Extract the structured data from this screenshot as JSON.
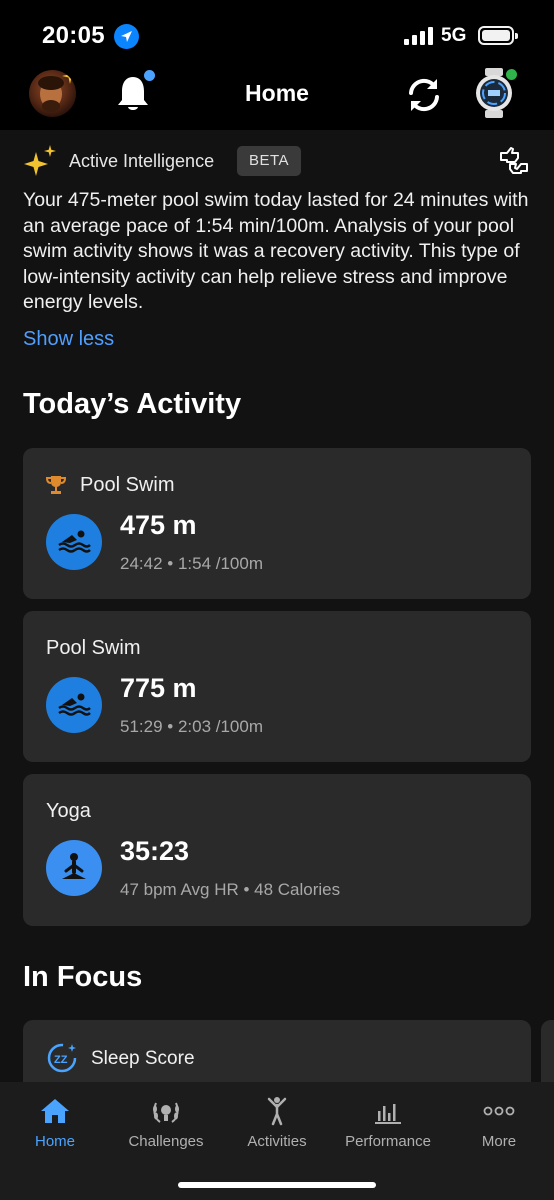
{
  "status_bar": {
    "time": "20:05",
    "network": "5G"
  },
  "header": {
    "title": "Home"
  },
  "insight": {
    "label": "Active Intelligence",
    "badge": "BETA",
    "text": "Your 475-meter pool swim today lasted for 24 minutes with an average pace of 1:54 min/100m. Analysis of your pool swim activity shows it was a recovery activity. This type of low-intensity activity can help relieve stress and improve energy levels.",
    "show_less": "Show less"
  },
  "today": {
    "title": "Today’s Activity",
    "activities": [
      {
        "name": "Pool Swim",
        "metric": "475 m",
        "detail": "24:42 • 1:54 /100m",
        "icon": "swim-icon",
        "badge_icon": "trophy-icon"
      },
      {
        "name": "Pool Swim",
        "metric": "775 m",
        "detail": "51:29 • 2:03 /100m",
        "icon": "swim-icon"
      },
      {
        "name": "Yoga",
        "metric": "35:23",
        "detail": "47 bpm Avg HR • 48 Calories",
        "icon": "yoga-icon"
      }
    ]
  },
  "in_focus": {
    "title": "In Focus",
    "cards": [
      {
        "label": "Sleep Score",
        "icon": "sleep-icon"
      }
    ]
  },
  "tabs": [
    {
      "label": "Home",
      "icon": "home-icon",
      "active": true
    },
    {
      "label": "Challenges",
      "icon": "laurel-icon"
    },
    {
      "label": "Activities",
      "icon": "person-icon"
    },
    {
      "label": "Performance",
      "icon": "bar-chart-icon"
    },
    {
      "label": "More",
      "icon": "more-icon"
    }
  ],
  "colors": {
    "accent": "#4aa3ff",
    "activity_icon_bg": "#1e7fe0",
    "card_bg": "#2a2a2a",
    "page_bg": "#121212"
  }
}
